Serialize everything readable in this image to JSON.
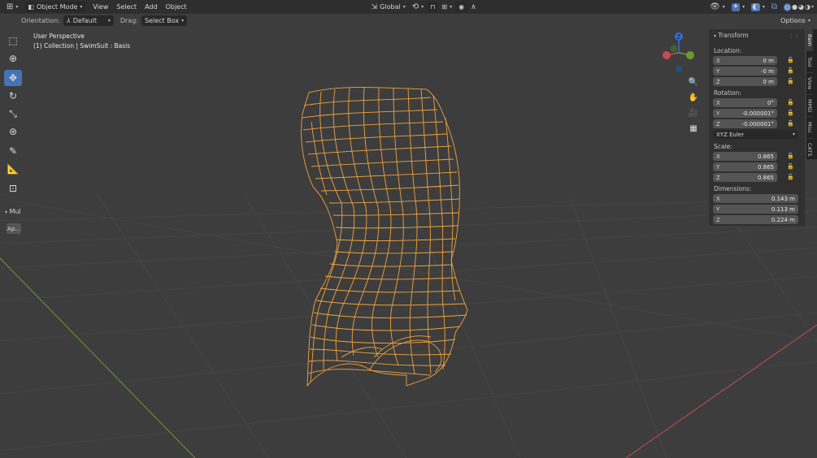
{
  "header": {
    "mode": "Object Mode",
    "menus": [
      "View",
      "Select",
      "Add",
      "Object"
    ],
    "transform_orientation": "Global",
    "options": "Options"
  },
  "tool_settings": {
    "orientation_label": "Orientation:",
    "orientation_value": "Default",
    "drag_label": "Drag:",
    "drag_value": "Select Box"
  },
  "viewport_info": {
    "perspective": "User Perspective",
    "collection": "(1) Collection | SwimSuit : Basis"
  },
  "gizmo": {
    "z_label": "Z"
  },
  "side_panel": {
    "mul_label": "Mul",
    "apply_button": "Ap..."
  },
  "sidebar": {
    "title": "Transform",
    "location_label": "Location:",
    "location": [
      {
        "axis": "X",
        "value": "0 m"
      },
      {
        "axis": "Y",
        "value": "-0 m"
      },
      {
        "axis": "Z",
        "value": "0 m"
      }
    ],
    "rotation_label": "Rotation:",
    "rotation": [
      {
        "axis": "X",
        "value": "0°"
      },
      {
        "axis": "Y",
        "value": "-0.000001°"
      },
      {
        "axis": "Z",
        "value": "-0.000001°"
      }
    ],
    "rotation_mode": "XYZ Euler",
    "scale_label": "Scale:",
    "scale": [
      {
        "axis": "X",
        "value": "0.865"
      },
      {
        "axis": "Y",
        "value": "0.865"
      },
      {
        "axis": "Z",
        "value": "0.865"
      }
    ],
    "dimensions_label": "Dimensions:",
    "dimensions": [
      {
        "axis": "X",
        "value": "0.143 m"
      },
      {
        "axis": "Y",
        "value": "0.113 m"
      },
      {
        "axis": "Z",
        "value": "0.224 m"
      }
    ],
    "tabs": [
      "Item",
      "Tool",
      "View",
      "MMD",
      "Misc",
      "CATS"
    ]
  },
  "colors": {
    "wireframe": "#f0a23c",
    "accent": "#4772b3",
    "axis_x": "#c94a52",
    "axis_y": "#6b9a2c"
  }
}
